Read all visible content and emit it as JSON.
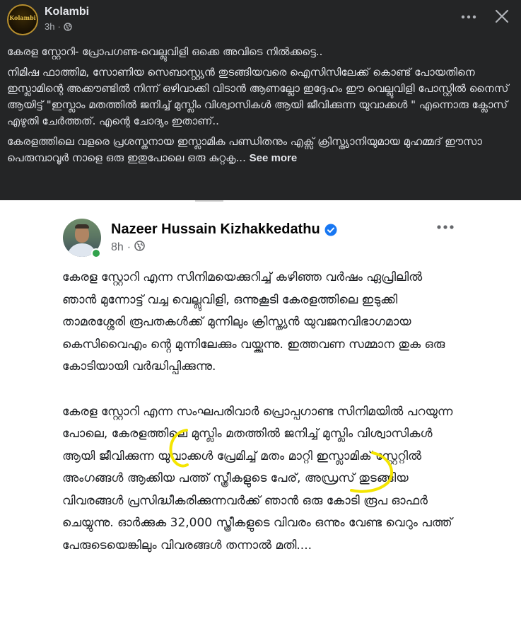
{
  "post": {
    "page_name": "Kolambi",
    "time": "3h",
    "logo_text": "Kolambi",
    "paragraphs": [
      "കേരള സ്റ്റോറി- പ്രോപഗണ്ട-വെല്ലുവിളി ഒക്കെ അവിടെ നിൽക്കട്ടെ..",
      "നിമിഷ ഫാത്തിമ, സോണിയ സെബാസ്റ്റ്യൻ തുടങ്ങിയവരെ ഐസിസിലേക്ക് കൊണ്ട് പോയതിനെ ഇസ്ലാമിന്റെ അക്കൗണ്ടിൽ നിന്ന് ഒഴിവാക്കി വിടാൻ ആണല്ലോ ഇദ്ദേഹം ഈ വെല്ലുവിളി പോസ്റ്റിൽ നൈസ് ആയിട്ട് \"ഇസ്ലാം മതത്തിൽ ജനിച്ച് മുസ്ലിം വിശ്വാസികൾ ആയി ജീവിക്കുന്ന യുവാക്കൾ \" എന്നൊരു ക്ലോസ് എഴുതി ചേർത്തത്. എന്റെ ചോദ്യം ഇതാണ്..",
      "കേരളത്തിലെ വളരെ പ്രശസ്തനായ ഇസ്ലാമിക പണ്ഡിതനും എക്സ് ക്രിസ്ത്യാനിയുമായ മുഹമ്മദ് ഈസാ പെരുമ്പാവൂർ നാളെ ഒരു ഇതുപോലെ ഒരു കുറ്റകൃ..."
    ],
    "see_more": "See more"
  },
  "shared": {
    "author_name": "Nazeer Hussain Kizhakkedathu",
    "time": "8h",
    "paragraphs": [
      "കേരള സ്റ്റോറി എന്ന സിനിമയെക്കുറിച്ച് കഴിഞ്ഞ വർഷം ഏപ്രിലിൽ ഞാൻ മുന്നോട്ട് വച്ച വെല്ലുവിളി, ഒന്നുകൂടി കേരളത്തിലെ ഇടുക്കി താമരശ്ശേരി രൂപതകൾക്ക് മുന്നിലും ക്രിസ്ത്യൻ യുവജനവിഭാഗമായ കെസിവൈഎം ൻ്റെ മുന്നിലേക്കും വയ്ക്കുന്നു. ഇത്തവണ സമ്മാന തുക ഒരു കോടിയായി വർദ്ധിപ്പിക്കുന്നു.",
      "കേരള സ്റ്റോറി എന്ന സംഘപരിവാർ പ്രൊപ്പഗാണ്ട സിനിമയിൽ പറയുന്ന പോലെ, കേരളത്തിലെ മുസ്ലിം മതത്തിൽ ജനിച്ച് മുസ്ലിം വിശ്വാസികൾ ആയി ജീവിക്കുന്ന യുവാക്കൾ പ്രേമിച്ച് മതം മാറ്റി ഇസ്ലാമിക് സ്റ്റേറ്റിൽ അംഗങ്ങൾ ആക്കിയ പത്ത് സ്ത്രീകളുടെ പേര്, അഡ്രസ് തുടങ്ങിയ വിവരങ്ങൾ പ്രസിദ്ധീകരിക്കുന്നവർക്ക് ഞാൻ ഒരു കോടി രൂപ ഓഫർ ചെയ്യുന്നു. ഓർക്കുക 32,000 സ്ത്രീകളുടെ വിവരം ഒന്നും വേണ്ട വെറും പത്ത് പേരുടെയെങ്കിലും വിവരങ്ങൾ തന്നാൽ മതി...."
    ]
  },
  "colors": {
    "dark_bg": "#242526",
    "dark_text": "#e4e6eb",
    "dark_secondary": "#b0b3b8",
    "verified_blue": "#1877f2",
    "online_green": "#31a24c",
    "highlight_yellow": "#f4e500"
  },
  "icons": [
    "globe-icon",
    "more-icon",
    "close-icon",
    "verified-icon",
    "highlight-bracket-icon"
  ]
}
